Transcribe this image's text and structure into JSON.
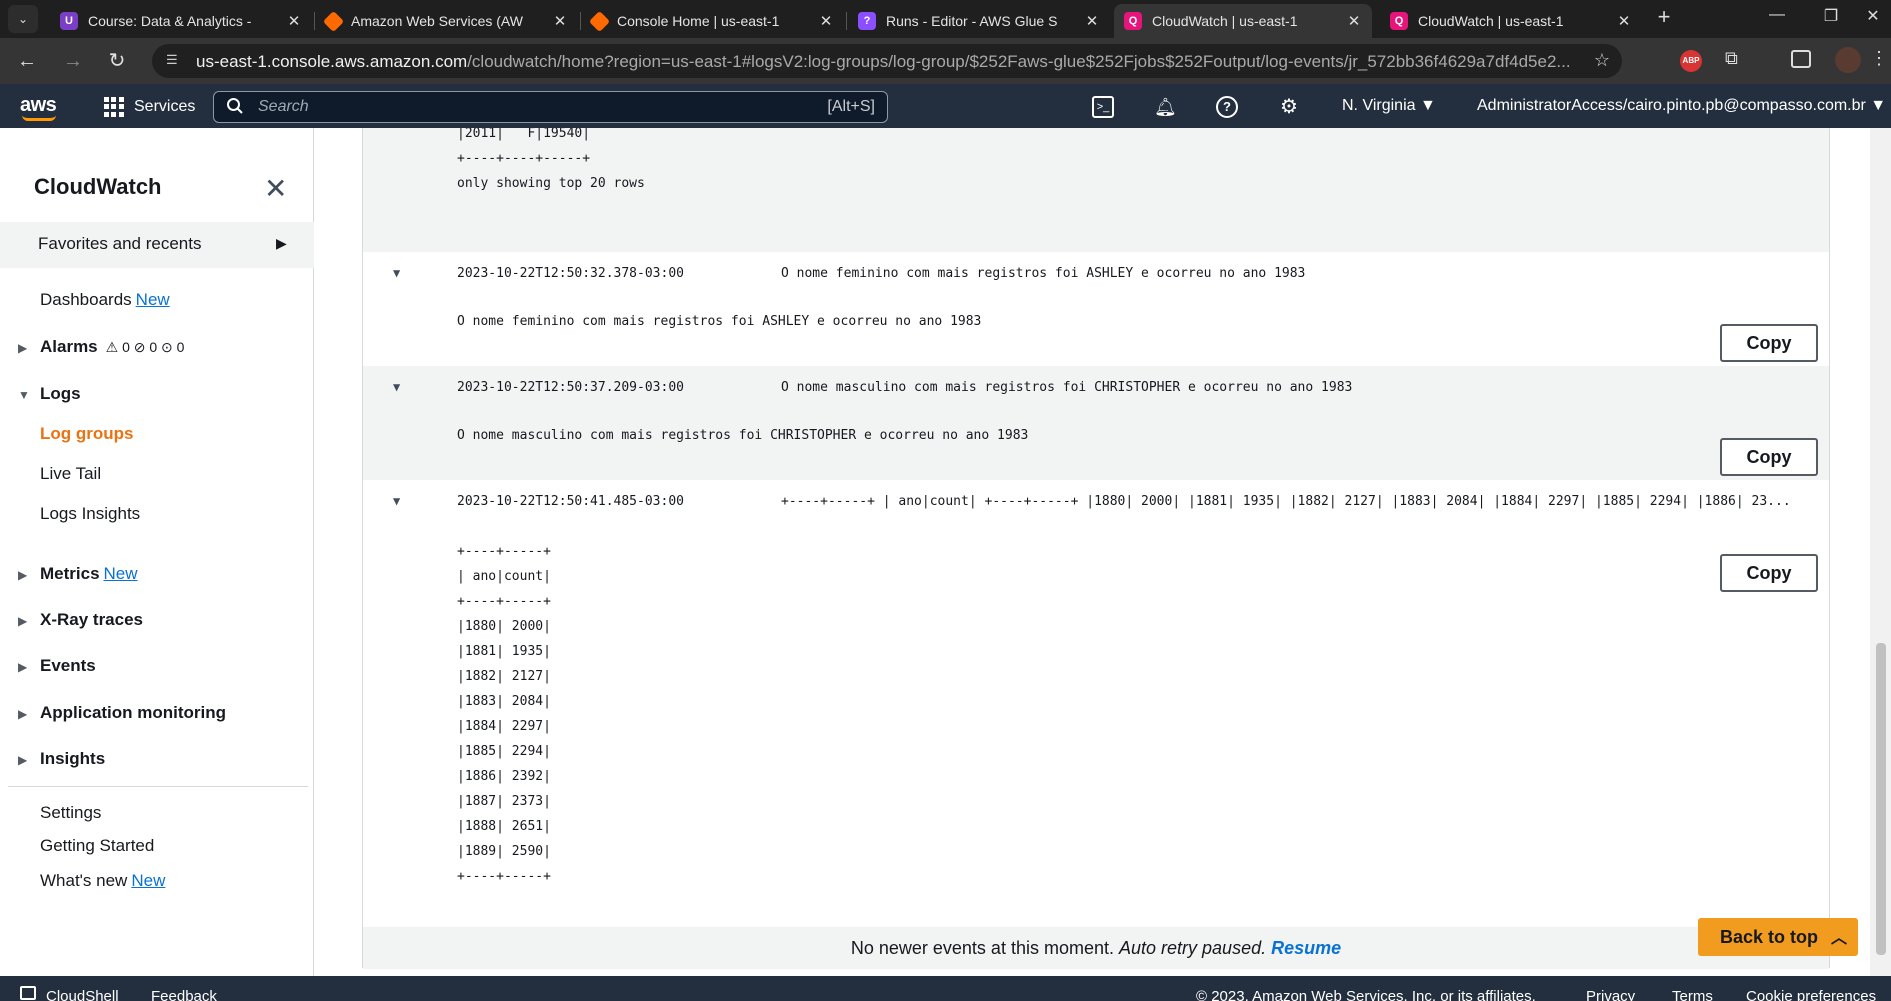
{
  "browser": {
    "tabs": [
      {
        "title": "Course: Data & Analytics - ",
        "favicon_color": "#7b3fc7",
        "favicon_glyph": "U"
      },
      {
        "title": "Amazon Web Services (AW",
        "favicon_color": "#ff6a00",
        "favicon_glyph": ""
      },
      {
        "title": "Console Home | us-east-1",
        "favicon_color": "#ff6a00",
        "favicon_glyph": ""
      },
      {
        "title": "Runs - Editor - AWS Glue S",
        "favicon_color": "#8c4fff",
        "favicon_glyph": "?"
      },
      {
        "title": "CloudWatch | us-east-1",
        "favicon_color": "#e7157b",
        "favicon_glyph": "Q"
      },
      {
        "title": "CloudWatch | us-east-1",
        "favicon_color": "#e7157b",
        "favicon_glyph": "Q"
      }
    ],
    "active_tab": 4,
    "url_host": "us-east-1.console.aws.amazon.com",
    "url_path": "/cloudwatch/home?region=us-east-1#logsV2:log-groups/log-group/$252Faws-glue$252Fjobs$252Foutput/log-events/jr_572bb36f4629a7df4d5e2..."
  },
  "aws_header": {
    "logo": "aws",
    "services_label": "Services",
    "search_placeholder": "Search",
    "search_shortcut": "[Alt+S]",
    "region": "N. Virginia ▼",
    "account": "AdministratorAccess/cairo.pinto.pb@compasso.com.br ▼"
  },
  "sidebar": {
    "title": "CloudWatch",
    "favorites": "Favorites and recents",
    "dashboards": "Dashboards",
    "new_badge": "New",
    "alarms": "Alarms",
    "alarm_counts": "⚠ 0  ⊘ 0  ⊙ 0",
    "logs": "Logs",
    "log_groups": "Log groups",
    "live_tail": "Live Tail",
    "logs_insights": "Logs Insights",
    "metrics": "Metrics",
    "xray": "X-Ray traces",
    "events": "Events",
    "app_monitoring": "Application monitoring",
    "insights": "Insights",
    "settings": "Settings",
    "getting_started": "Getting Started",
    "whats_new": "What's new"
  },
  "log": {
    "top_fragment": "|2011|   F|19540|\n+----+----+-----+\nonly showing top 20 rows",
    "events": [
      {
        "timestamp": "2023-10-22T12:50:32.378-03:00",
        "message": "O nome feminino com mais registros foi ASHLEY e ocorreu no ano 1983",
        "body": "O nome feminino com mais registros foi ASHLEY e ocorreu no ano 1983"
      },
      {
        "timestamp": "2023-10-22T12:50:37.209-03:00",
        "message": "O nome masculino com mais registros foi CHRISTOPHER e ocorreu no ano 1983",
        "body": "O nome masculino com mais registros foi CHRISTOPHER e ocorreu no ano 1983"
      },
      {
        "timestamp": "2023-10-22T12:50:41.485-03:00",
        "message": "+----+-----+ | ano|count| +----+-----+ |1880| 2000| |1881| 1935| |1882| 2127| |1883| 2084| |1884| 2297| |1885| 2294| |1886| 23...",
        "body": "+----+-----+\n| ano|count|\n+----+-----+\n|1880| 2000|\n|1881| 1935|\n|1882| 2127|\n|1883| 2084|\n|1884| 2297|\n|1885| 2294|\n|1886| 2392|\n|1887| 2373|\n|1888| 2651|\n|1889| 2590|\n+----+-----+"
      }
    ],
    "copy_label": "Copy",
    "no_newer_prefix": "No newer events at this moment.",
    "no_newer_italic": "Auto retry paused.",
    "resume": "Resume",
    "back_to_top": "Back to top"
  },
  "footer": {
    "cloudshell": "CloudShell",
    "feedback": "Feedback",
    "copyright": "© 2023, Amazon Web Services, Inc. or its affiliates.",
    "privacy": "Privacy",
    "terms": "Terms",
    "cookies": "Cookie preferences"
  },
  "colors": {
    "aws_navy": "#232f3e",
    "aws_orange": "#ff9900",
    "active_nav": "#ec7211",
    "link_blue": "#0972d3",
    "back_to_top": "#f29c1f"
  }
}
